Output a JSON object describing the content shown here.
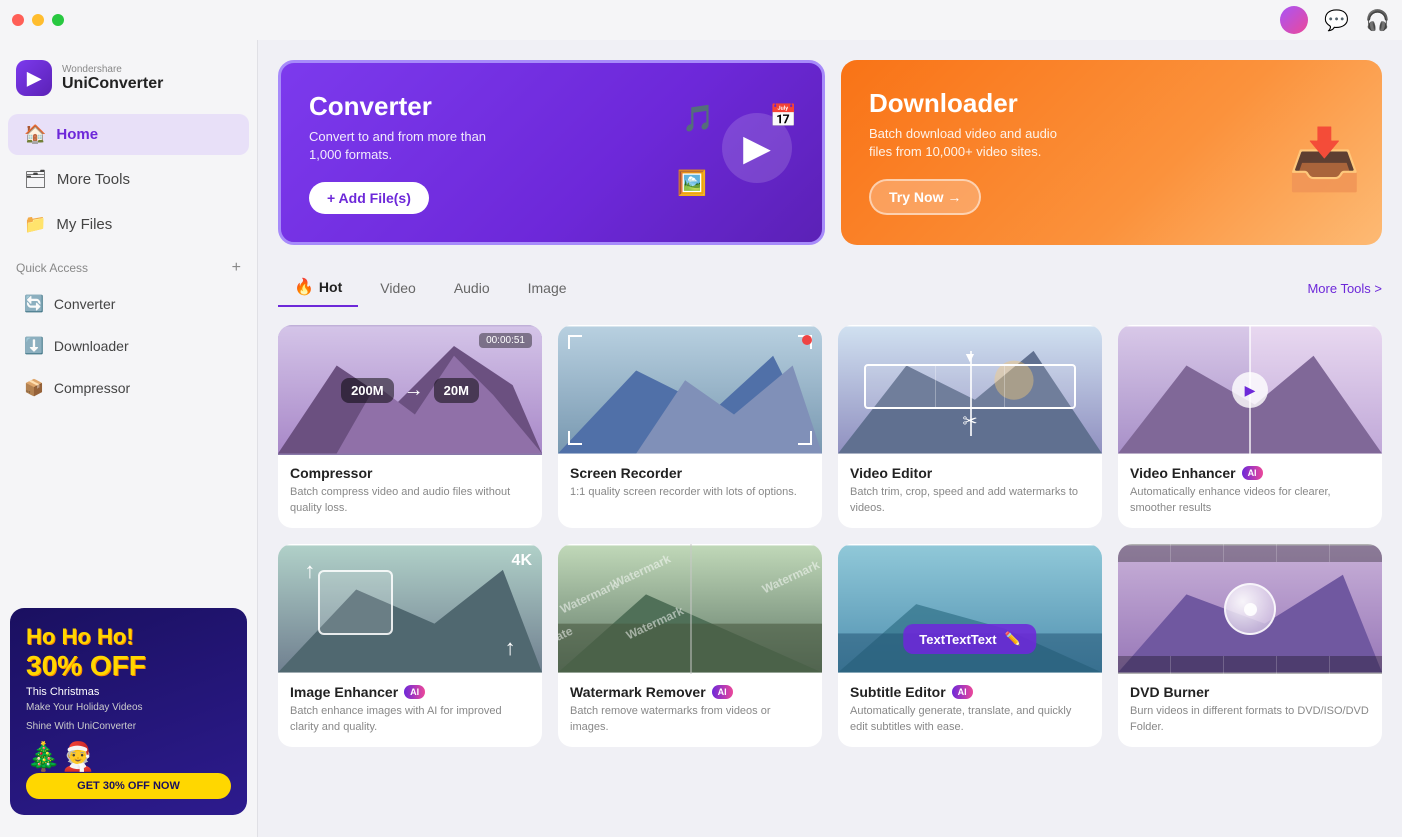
{
  "app": {
    "brand": "Wondershare",
    "name": "UniConverter"
  },
  "titlebar": {
    "avatar_alt": "user-avatar",
    "chat_icon": "💬",
    "headset_icon": "🎧"
  },
  "sidebar": {
    "nav": [
      {
        "id": "home",
        "label": "Home",
        "icon": "🏠",
        "active": true
      },
      {
        "id": "more-tools",
        "label": "More Tools",
        "icon": "🗂"
      },
      {
        "id": "my-files",
        "label": "My Files",
        "icon": "📁"
      }
    ],
    "quick_access_label": "Quick Access",
    "quick_access_add": "+",
    "sub_nav": [
      {
        "id": "converter",
        "label": "Converter",
        "icon": "🔄"
      },
      {
        "id": "downloader",
        "label": "Downloader",
        "icon": "⬇️"
      },
      {
        "id": "compressor",
        "label": "Compressor",
        "icon": "📦"
      }
    ],
    "promo": {
      "ho": "Ho Ho Ho!",
      "off": "30% OFF",
      "title": "This Christmas",
      "subtitle": "Make Your Holiday Videos",
      "subtitle2": "Shine With UniConverter",
      "btn": "GET 30% OFF NOW"
    }
  },
  "hero": {
    "converter": {
      "title": "Converter",
      "desc": "Convert to and from more than 1,000 formats.",
      "btn": "+ Add File(s)"
    },
    "downloader": {
      "title": "Downloader",
      "desc": "Batch download video and audio files from 10,000+ video sites.",
      "btn": "Try Now →"
    }
  },
  "tabs": {
    "items": [
      {
        "id": "hot",
        "label": "Hot",
        "active": true,
        "icon": "🔥"
      },
      {
        "id": "video",
        "label": "Video",
        "active": false
      },
      {
        "id": "audio",
        "label": "Audio",
        "active": false
      },
      {
        "id": "image",
        "label": "Image",
        "active": false
      }
    ],
    "more_tools": "More Tools >"
  },
  "tools": [
    {
      "id": "compressor",
      "name": "Compressor",
      "desc": "Batch compress video and audio files without quality loss.",
      "ai": false,
      "thumb_type": "compressor",
      "from": "200M",
      "to": "20M",
      "timer": "00:00:51"
    },
    {
      "id": "screen-recorder",
      "name": "Screen Recorder",
      "desc": "1:1 quality screen recorder with lots of options.",
      "ai": false,
      "thumb_type": "screen-recorder"
    },
    {
      "id": "video-editor",
      "name": "Video Editor",
      "desc": "Batch trim, crop, speed and add watermarks to videos.",
      "ai": false,
      "thumb_type": "video-editor"
    },
    {
      "id": "video-enhancer",
      "name": "Video Enhancer",
      "desc": "Automatically enhance videos for clearer, smoother results",
      "ai": true,
      "thumb_type": "video-enhancer"
    },
    {
      "id": "image-enhancer",
      "name": "Image Enhancer",
      "desc": "Batch enhance images with AI for improved clarity and quality.",
      "ai": true,
      "thumb_type": "image-enhancer"
    },
    {
      "id": "watermark-remover",
      "name": "Watermark Remover",
      "desc": "Batch remove watermarks from videos or images.",
      "ai": true,
      "thumb_type": "watermark"
    },
    {
      "id": "subtitle-editor",
      "name": "Subtitle Editor",
      "desc": "Automatically generate, translate, and quickly edit subtitles with ease.",
      "ai": true,
      "thumb_type": "subtitle"
    },
    {
      "id": "dvd-burner",
      "name": "DVD Burner",
      "desc": "Burn videos in different formats to DVD/ISO/DVD Folder.",
      "ai": false,
      "thumb_type": "dvd"
    }
  ]
}
